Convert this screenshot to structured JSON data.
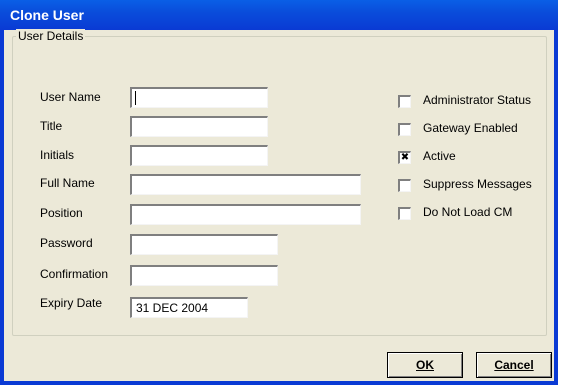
{
  "window": {
    "title": "Clone User"
  },
  "group": {
    "legend": "User Details"
  },
  "fields": [
    {
      "label": "User Name",
      "value": ""
    },
    {
      "label": "Title",
      "value": ""
    },
    {
      "label": "Initials",
      "value": ""
    },
    {
      "label": "Full Name",
      "value": ""
    },
    {
      "label": "Position",
      "value": ""
    },
    {
      "label": "Password",
      "value": ""
    },
    {
      "label": "Confirmation",
      "value": ""
    },
    {
      "label": "Expiry Date",
      "value": "31 DEC 2004"
    }
  ],
  "checkboxes": [
    {
      "label": "Administrator Status",
      "checked": false,
      "mark": ""
    },
    {
      "label": "Gateway Enabled",
      "checked": false,
      "mark": ""
    },
    {
      "label": "Active",
      "checked": true,
      "mark": "✖"
    },
    {
      "label": "Suppress Messages",
      "checked": false,
      "mark": ""
    },
    {
      "label": "Do Not Load CM",
      "checked": false,
      "mark": ""
    }
  ],
  "buttons": {
    "ok": "OK",
    "cancel": "Cancel"
  }
}
